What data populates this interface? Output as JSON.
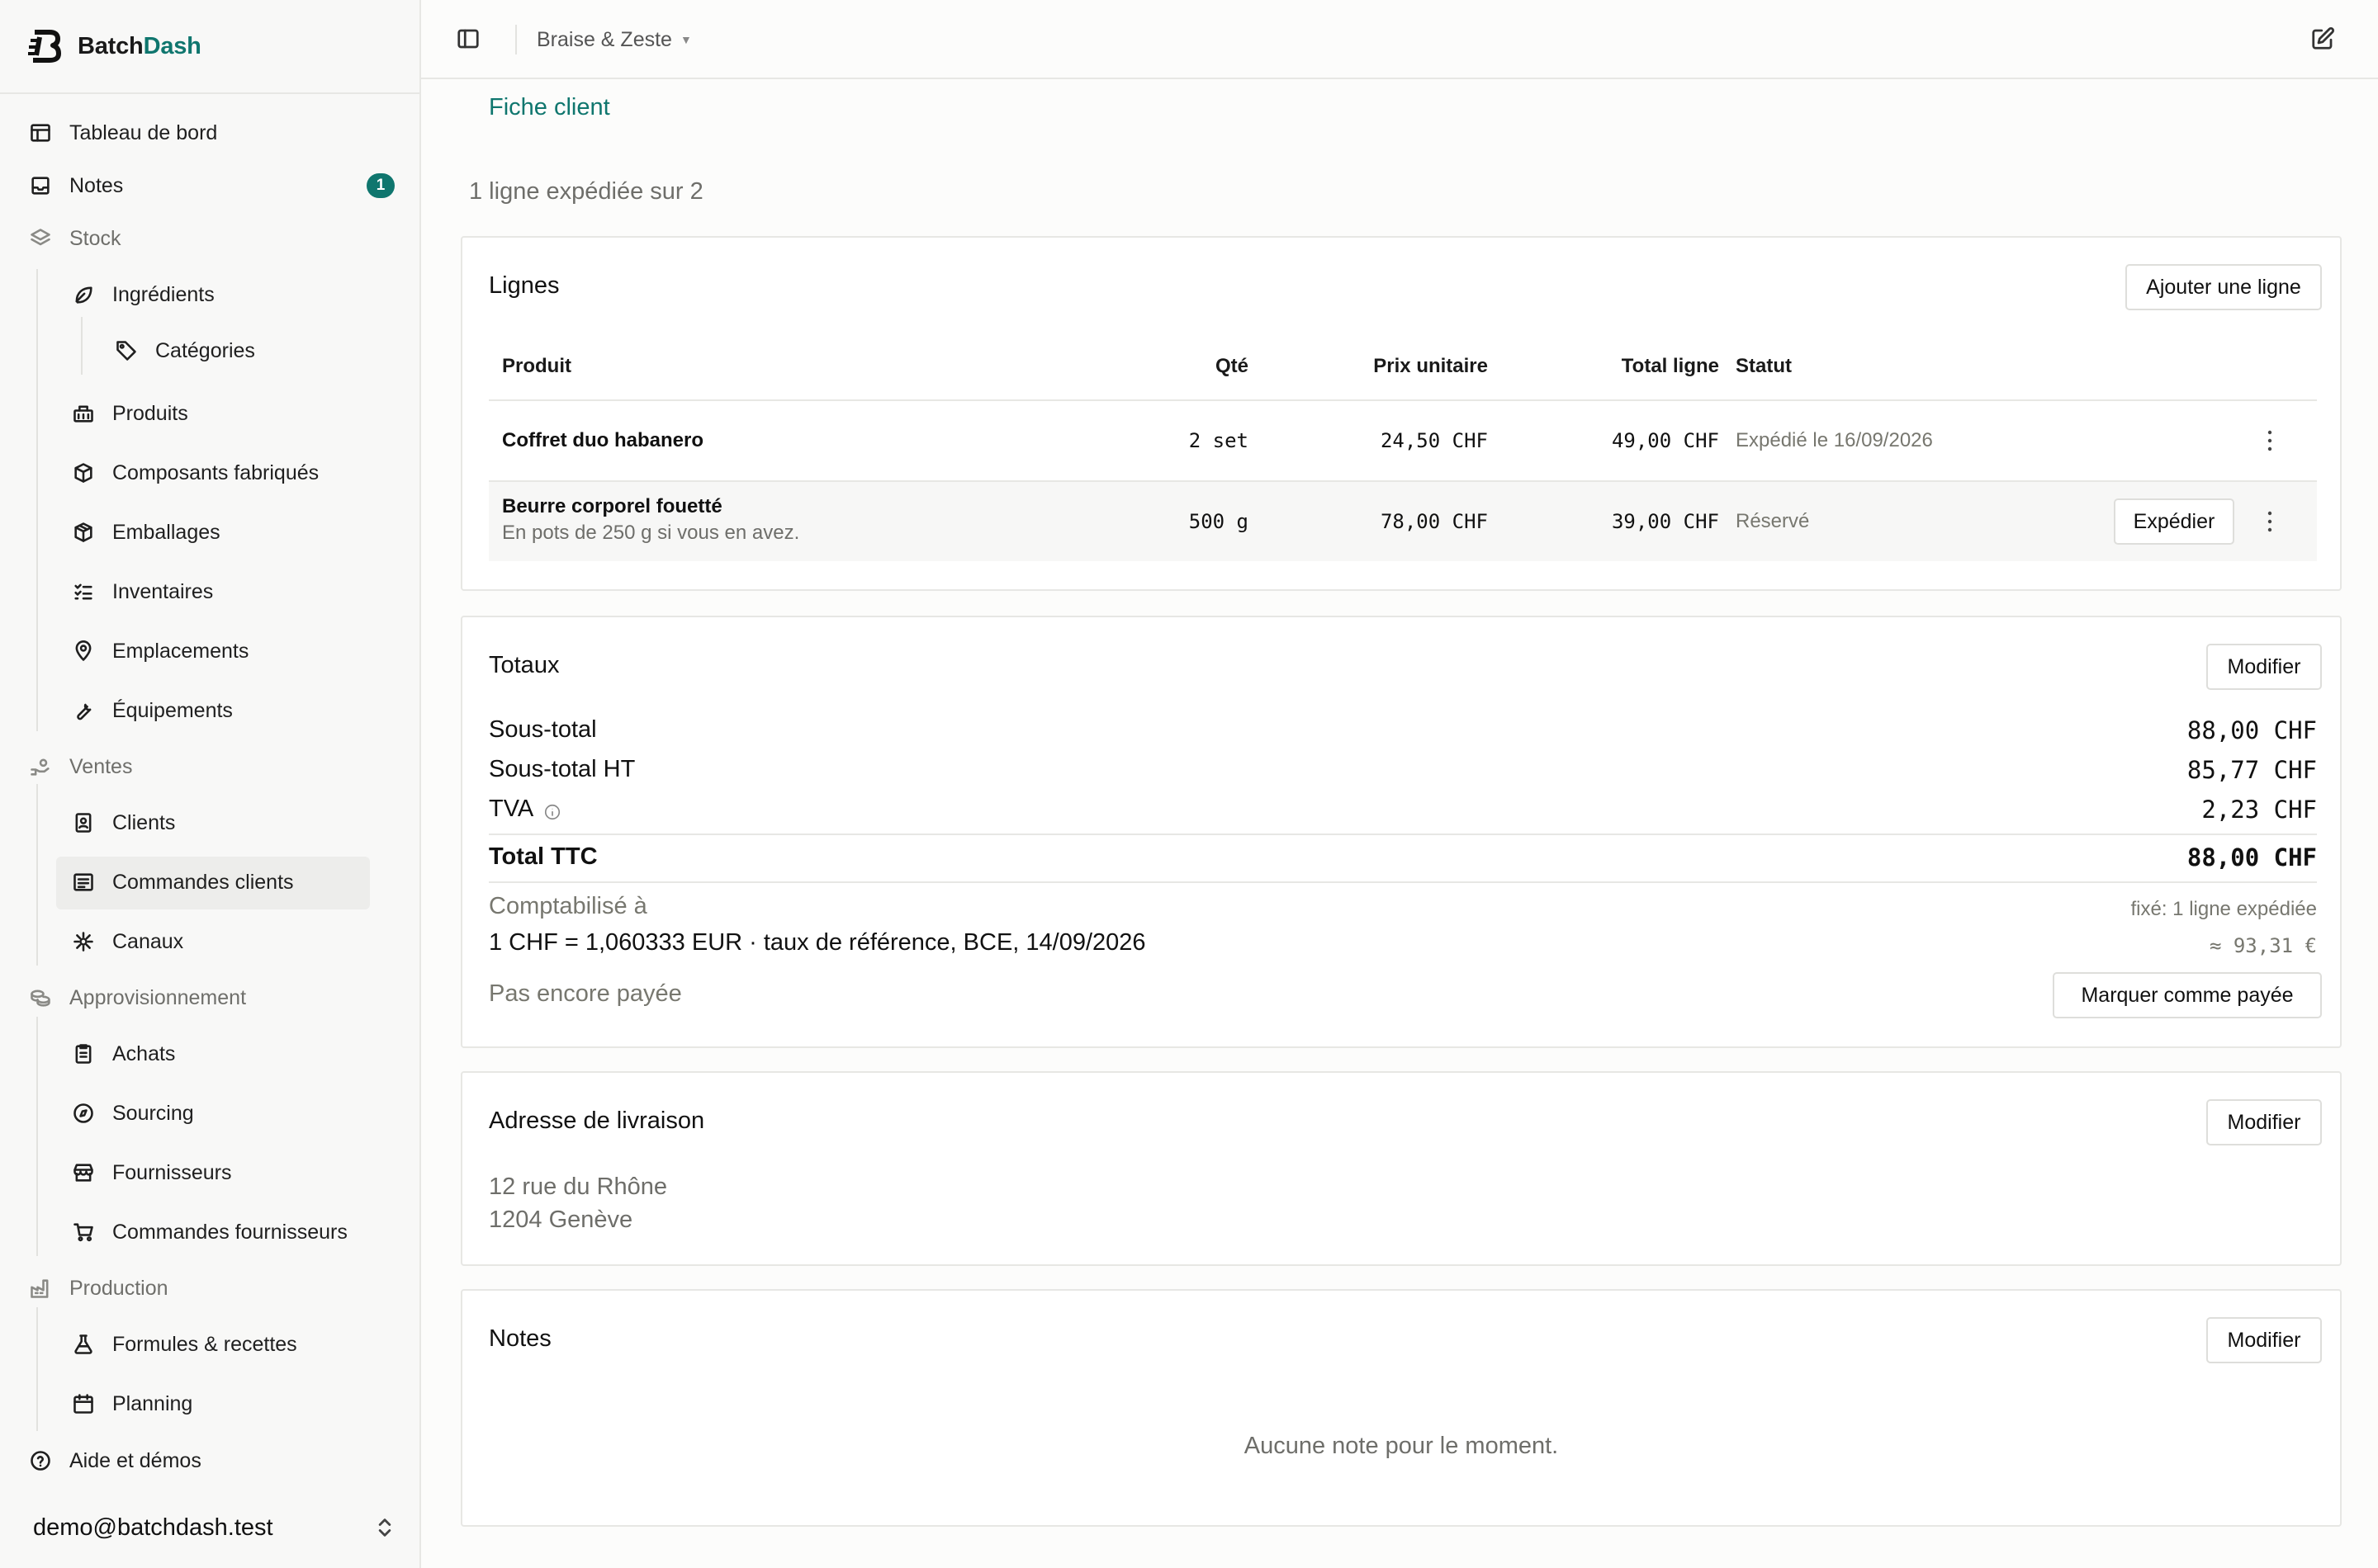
{
  "app": {
    "brand_prefix": "Batch",
    "brand_accent": "Dash",
    "accent_color": "#0f766e"
  },
  "sidebar": {
    "dashboard": "Tableau de bord",
    "notes": {
      "label": "Notes",
      "badge": "1"
    },
    "stock": {
      "label": "Stock",
      "ingredients": "Ingrédients",
      "categories": "Catégories",
      "products": "Produits",
      "components": "Composants fabriqués",
      "packaging": "Emballages",
      "inventories": "Inventaires",
      "locations": "Emplacements",
      "equipment": "Équipements"
    },
    "sales": {
      "label": "Ventes",
      "clients": "Clients",
      "client_orders": "Commandes clients",
      "channels": "Canaux"
    },
    "supply": {
      "label": "Approvisionnement",
      "purchases": "Achats",
      "sourcing": "Sourcing",
      "suppliers": "Fournisseurs",
      "supplier_orders": "Commandes fournisseurs"
    },
    "production": {
      "label": "Production",
      "formulas": "Formules & recettes",
      "planning": "Planning"
    },
    "help": "Aide et démos",
    "user_email": "demo@batchdash.test"
  },
  "topbar": {
    "workspace": "Braise & Zeste"
  },
  "main": {
    "client_link": "Fiche client",
    "shipped_count": "1 ligne expédiée sur 2",
    "lines": {
      "title": "Lignes",
      "add_button": "Ajouter une ligne",
      "columns": [
        "Produit",
        "Qté",
        "Prix unitaire",
        "Total ligne",
        "Statut"
      ],
      "rows": [
        {
          "product": "Coffret duo habanero",
          "note": "",
          "qty": "2 set",
          "unit_price": "24,50 CHF",
          "total": "49,00 CHF",
          "status": "Expédié le 16/09/2026",
          "action": ""
        },
        {
          "product": "Beurre corporel fouetté",
          "note": "En pots de 250 g si vous en avez.",
          "qty": "500 g",
          "unit_price": "78,00 CHF",
          "total": "39,00 CHF",
          "status": "Réservé",
          "action": "Expédier"
        }
      ]
    },
    "totals": {
      "title": "Totaux",
      "edit_button": "Modifier",
      "subtotal_label": "Sous-total",
      "subtotal": "88,00 CHF",
      "subtotal_ht_label": "Sous-total HT",
      "subtotal_ht": "85,77 CHF",
      "vat_label": "TVA",
      "vat": "2,23 CHF",
      "total_ttc_label": "Total TTC",
      "total_ttc": "88,00 CHF",
      "booked_label": "Comptabilisé à",
      "fixed_note": "fixé: 1 ligne expédiée",
      "rate_line": "1 CHF = 1,060333 EUR · taux de référence, BCE, 14/09/2026",
      "converted": "≈ 93,31 €",
      "payment_status": "Pas encore payée",
      "mark_paid_button": "Marquer comme payée"
    },
    "delivery": {
      "title": "Adresse de livraison",
      "edit_button": "Modifier",
      "line1": "12 rue du Rhône",
      "line2": "1204 Genève"
    },
    "notes": {
      "title": "Notes",
      "edit_button": "Modifier",
      "empty": "Aucune note pour le moment."
    }
  }
}
